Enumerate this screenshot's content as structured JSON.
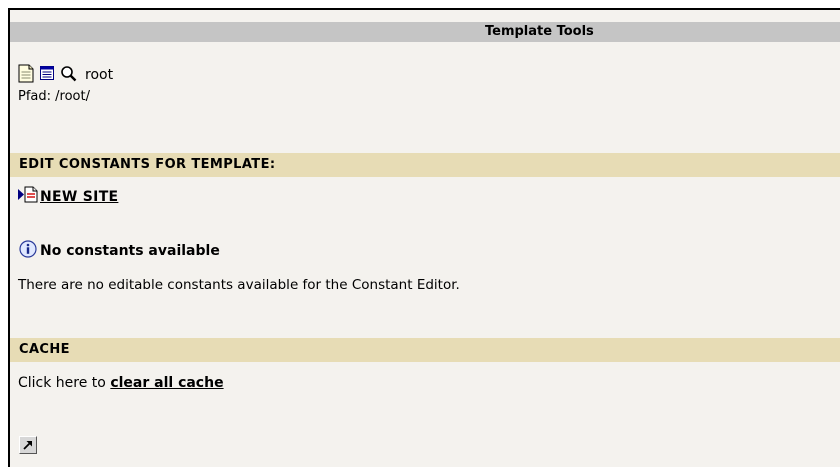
{
  "header": {
    "title": "Template Tools"
  },
  "toolbar": {
    "icons": [
      "page-icon",
      "list-view-icon",
      "search-icon"
    ],
    "root_label": "root",
    "path_label": "Pfad: /root/"
  },
  "constants_section": {
    "heading": "EDIT CONSTANTS FOR TEMPLATE:",
    "site_link": "NEW SITE",
    "info_title": "No constants available",
    "info_text": "There are no editable constants available for the Constant Editor."
  },
  "cache_section": {
    "heading": "CACHE",
    "prefix_text": "Click here to",
    "link_text": "clear all cache"
  },
  "footer": {
    "shortcut_icon": "shortcut-arrow-icon"
  }
}
